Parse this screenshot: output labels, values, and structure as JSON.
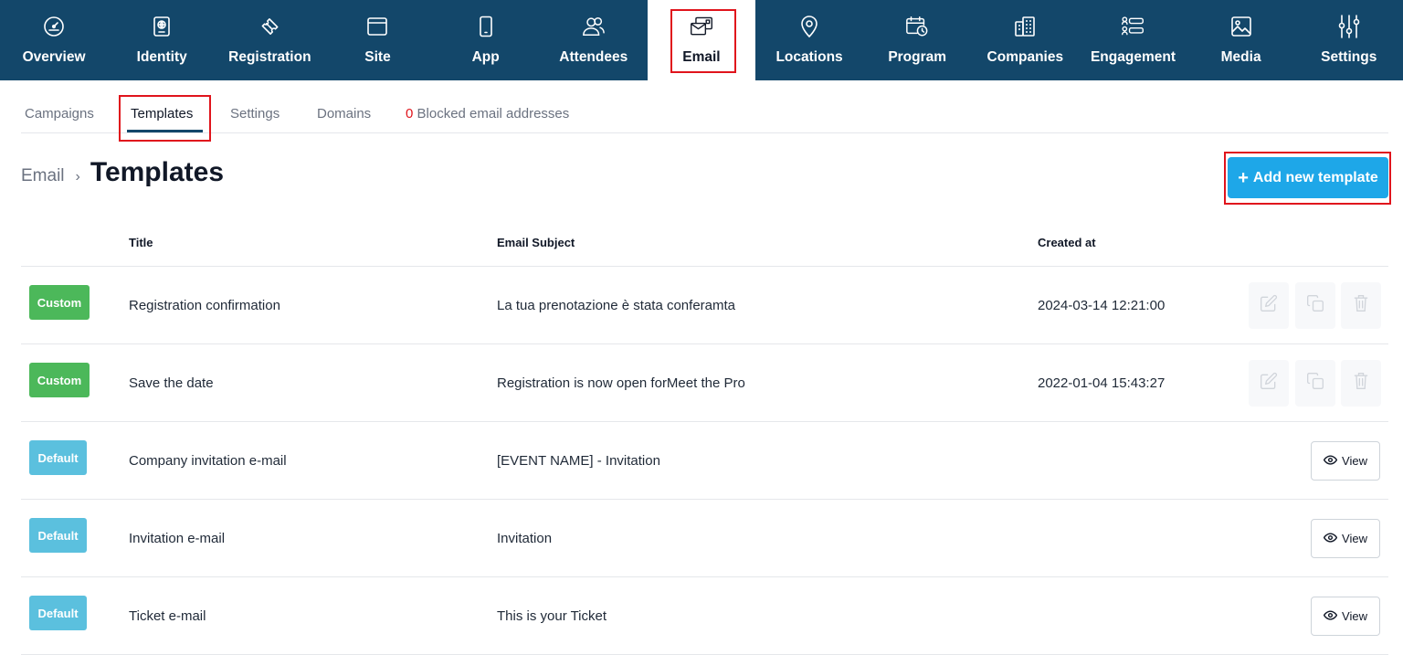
{
  "topnav": {
    "items": [
      {
        "label": "Overview",
        "icon": "gauge-icon"
      },
      {
        "label": "Identity",
        "icon": "passport-icon"
      },
      {
        "label": "Registration",
        "icon": "ticket-icon"
      },
      {
        "label": "Site",
        "icon": "browser-window-icon"
      },
      {
        "label": "App",
        "icon": "smartphone-icon"
      },
      {
        "label": "Attendees",
        "icon": "users-icon"
      },
      {
        "label": "Email",
        "icon": "email-cards-icon"
      },
      {
        "label": "Locations",
        "icon": "map-pin-icon"
      },
      {
        "label": "Program",
        "icon": "calendar-clock-icon"
      },
      {
        "label": "Companies",
        "icon": "building-icon"
      },
      {
        "label": "Engagement",
        "icon": "engagement-list-icon"
      },
      {
        "label": "Media",
        "icon": "image-icon"
      },
      {
        "label": "Settings",
        "icon": "sliders-icon"
      }
    ],
    "active": "Email"
  },
  "subtabs": {
    "campaigns": "Campaigns",
    "templates": "Templates",
    "settings": "Settings",
    "domains": "Domains",
    "blocked_count": "0",
    "blocked_label": "Blocked email addresses",
    "active": "Templates"
  },
  "breadcrumb": {
    "parent": "Email",
    "separator": "›",
    "title": "Templates"
  },
  "add_button": {
    "plus": "+",
    "label": "Add new template"
  },
  "table": {
    "headers": {
      "title": "Title",
      "subject": "Email Subject",
      "created": "Created at"
    },
    "rows": [
      {
        "badge": "Custom",
        "title": "Registration confirmation",
        "subject": "La tua prenotazione è stata conferamta",
        "created": "2024-03-14 12:21:00"
      },
      {
        "badge": "Custom",
        "title": "Save the date",
        "subject": "Registration is now open forMeet the Pro",
        "created": "2022-01-04 15:43:27"
      },
      {
        "badge": "Default",
        "title": "Company invitation e-mail",
        "subject": "[EVENT NAME] - Invitation",
        "created": "",
        "view_label": "View"
      },
      {
        "badge": "Default",
        "title": "Invitation e-mail",
        "subject": "Invitation",
        "created": "",
        "view_label": "View"
      },
      {
        "badge": "Default",
        "title": "Ticket e-mail",
        "subject": "This is your Ticket",
        "created": "",
        "view_label": "View"
      }
    ]
  },
  "colors": {
    "nav_background": "#13476a",
    "primary_button": "#1ea7e8",
    "custom_badge": "#4cb85a",
    "default_badge": "#5bc0de",
    "highlight_red": "#e0141c"
  }
}
